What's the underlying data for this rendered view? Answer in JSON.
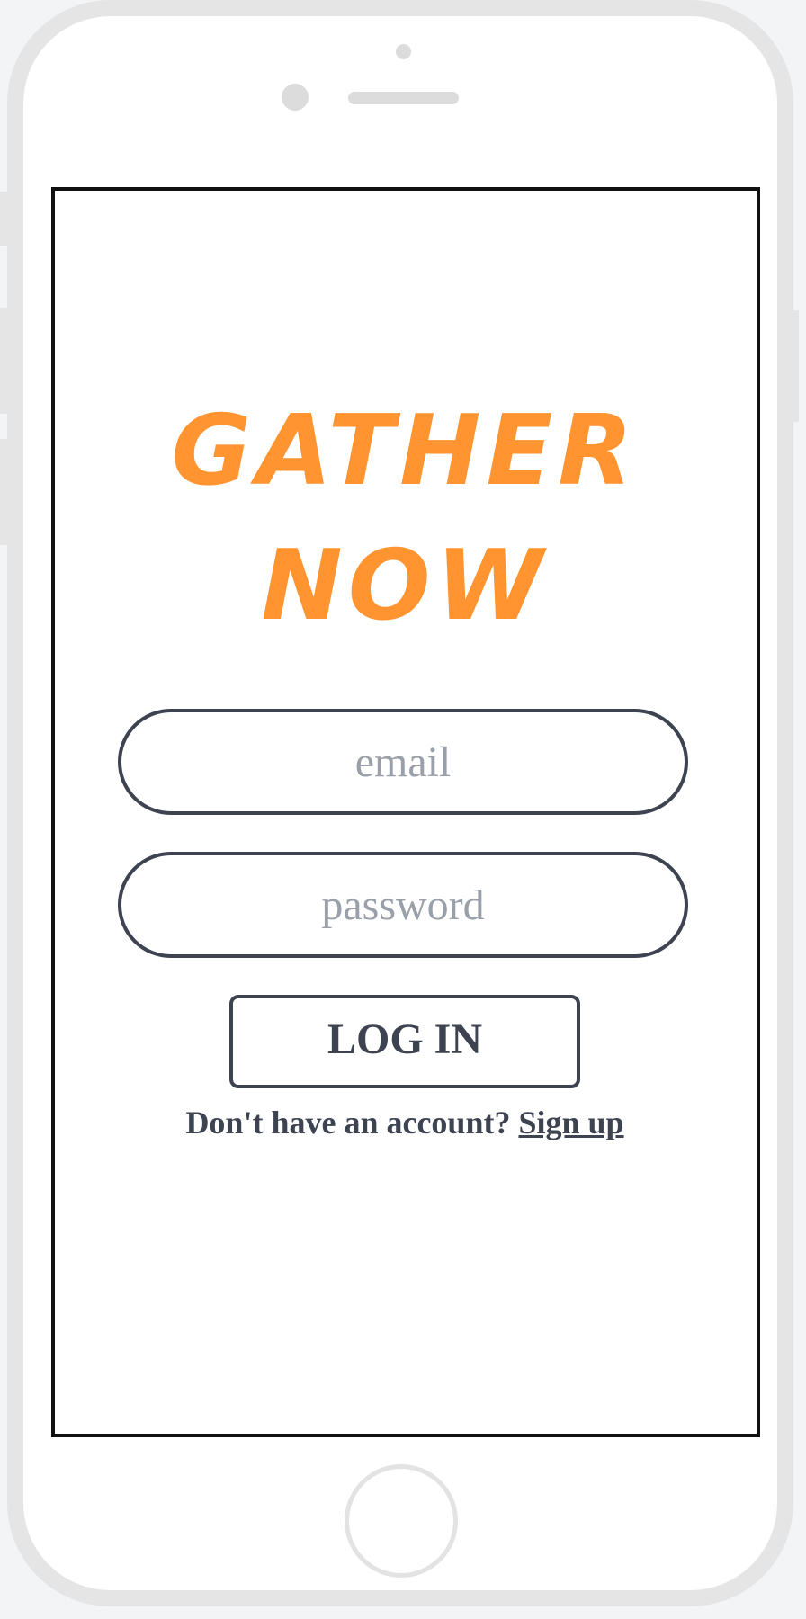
{
  "app": {
    "title_line1": "GATHER",
    "title_line2": "NOW",
    "accent_color": "#ff9430",
    "text_color": "#3d4350"
  },
  "login_form": {
    "email_placeholder": "email",
    "password_placeholder": "password",
    "login_label": "LOG IN",
    "signup_prompt": "Don't have an account?",
    "signup_link_label": "Sign up"
  },
  "device": {
    "frame_color": "#e5e5e5"
  }
}
